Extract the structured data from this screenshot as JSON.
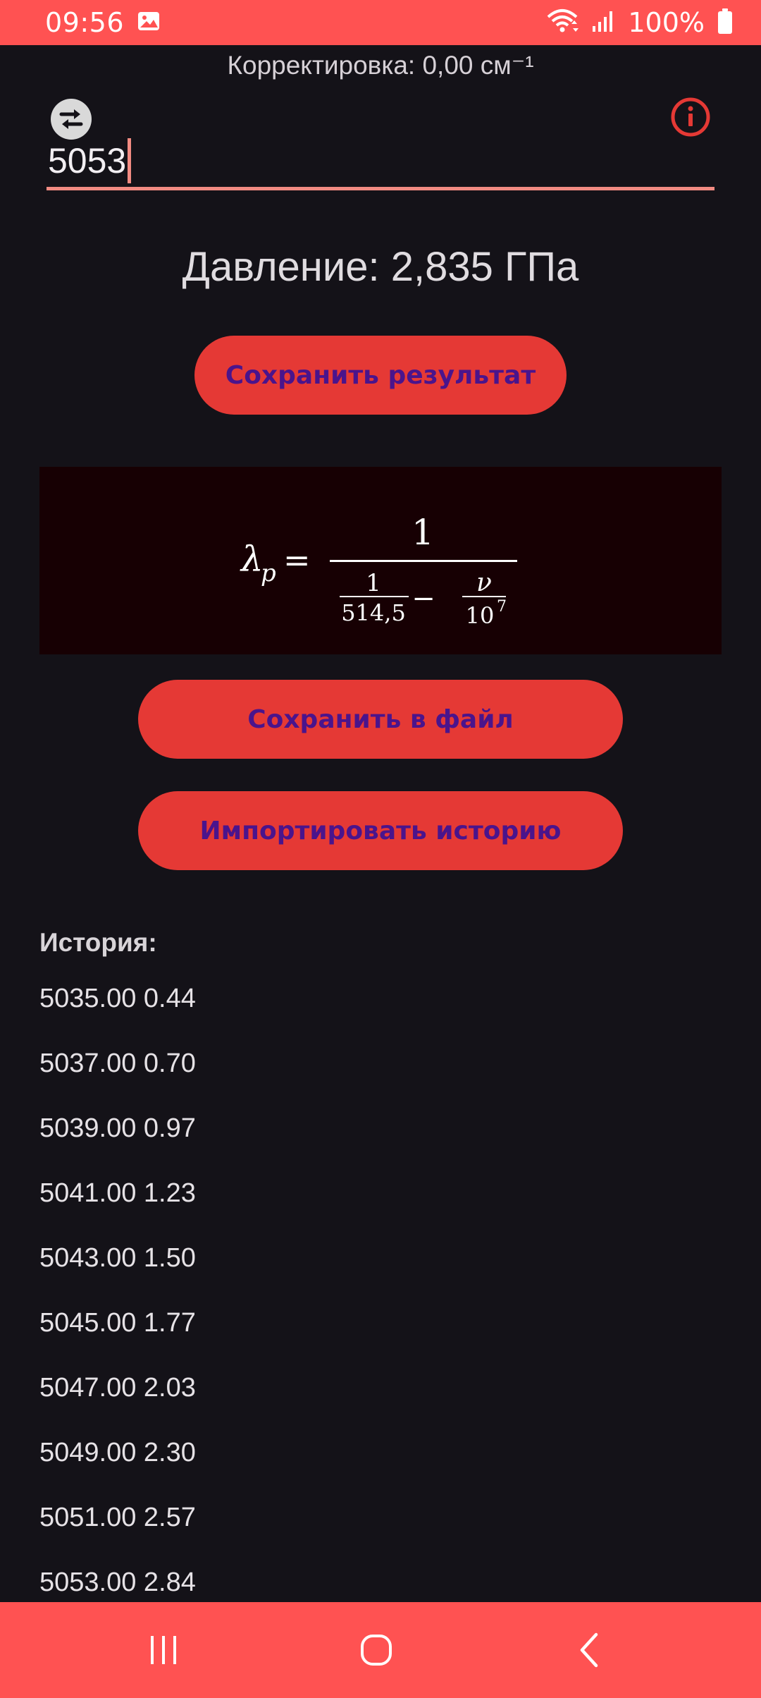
{
  "status": {
    "time": "09:56",
    "battery_pct": "100%",
    "icons": [
      "image-icon",
      "wifi-icon",
      "signal-icon",
      "battery-icon"
    ]
  },
  "correction_text": "Корректировка: 0,00 см⁻¹",
  "input": {
    "value": "5053"
  },
  "pressure_text": "Давление: 2,835 ГПа",
  "buttons": {
    "save_result": "Сохранить результат",
    "save_file": "Сохранить в файл",
    "import_history": "Импортировать историю"
  },
  "formula": {
    "lhs_symbol": "λ",
    "lhs_subscript": "p",
    "equals": "=",
    "numerator": "1",
    "inner_left_num": "1",
    "inner_left_den": "514,5",
    "minus": "−",
    "inner_right_num": "ν",
    "inner_right_den_base": "10",
    "inner_right_den_exp": "7"
  },
  "history": {
    "title": "История:",
    "items": [
      "5035.00 0.44",
      "5037.00 0.70",
      "5039.00 0.97",
      "5041.00 1.23",
      "5043.00 1.50",
      "5045.00 1.77",
      "5047.00 2.03",
      "5049.00 2.30",
      "5051.00 2.57",
      "5053.00 2.84"
    ]
  },
  "colors": {
    "accent": "#ff5252",
    "button": "#e53935",
    "button_text": "#4a148c",
    "background": "#141218",
    "formula_bg": "#170003",
    "underline": "#f28b82"
  }
}
